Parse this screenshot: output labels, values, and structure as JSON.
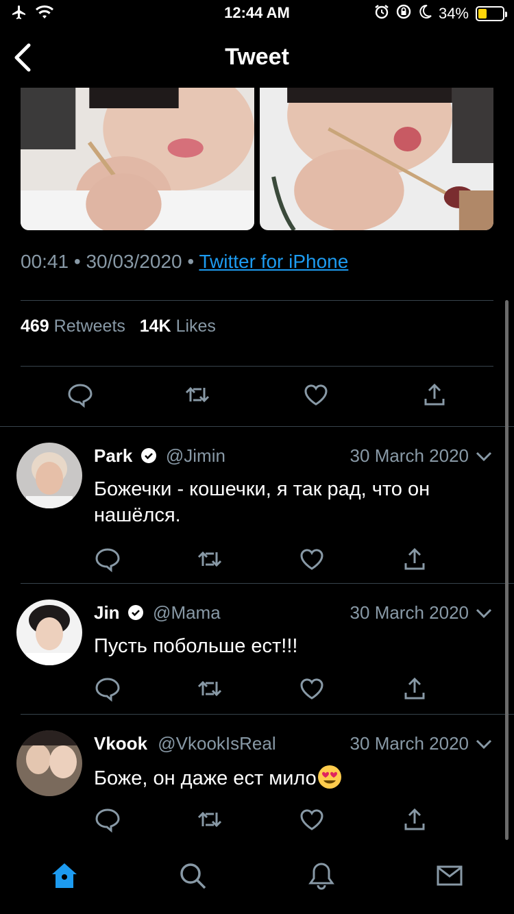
{
  "status_bar": {
    "time": "12:44 AM",
    "battery_percent": "34%",
    "battery_level": 0.34,
    "battery_color": "#ffd60a"
  },
  "nav": {
    "title": "Tweet",
    "back_icon": "chevron-left-icon"
  },
  "tweet": {
    "time": "00:41",
    "date": "30/03/2020",
    "source": "Twitter for iPhone",
    "retweets_count": "469",
    "retweets_label": "Retweets",
    "likes_count": "14K",
    "likes_label": "Likes"
  },
  "replies": [
    {
      "name": "Park",
      "handle": "@Jimin",
      "date": "30 March 2020",
      "text": "Божечки - кошечки, я так рад, что он нашёлся."
    },
    {
      "name": "Jin",
      "handle": "@Mama",
      "date": "30 March 2020",
      "text": "Пусть побольше ест!!!"
    },
    {
      "name": "Vkook",
      "handle": "@VkookIsReal",
      "date": "30 March 2020",
      "text": "Боже, он даже ест мило"
    }
  ],
  "colors": {
    "accent": "#1d9bf0",
    "secondary_text": "#8899a6",
    "divider": "#38444d",
    "background": "#000000"
  },
  "tabs": [
    "home-icon",
    "search-icon",
    "notifications-icon",
    "messages-icon"
  ]
}
